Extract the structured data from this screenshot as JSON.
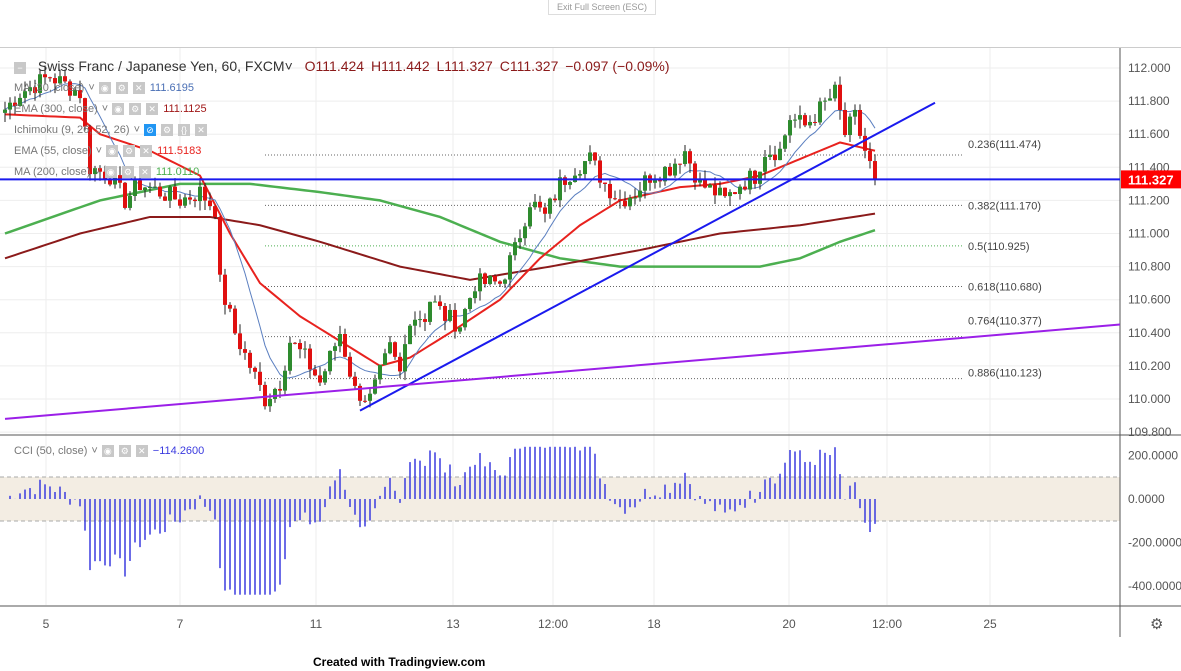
{
  "header": {
    "exit_fullscreen": "Exit Full Screen (ESC)"
  },
  "symbol": {
    "name": "Swiss Franc / Japanese Yen, 60, FXCM",
    "open": "O111.424",
    "high": "H111.442",
    "low": "L111.327",
    "close": "C111.327",
    "change": "−0.097 (−0.09%)"
  },
  "indicators": [
    {
      "label": "MA (20, close)",
      "value": "111.6195",
      "color": "#4a6fb5"
    },
    {
      "label": "EMA (300, close)",
      "value": "111.1125",
      "color": "#a01818"
    },
    {
      "label": "Ichimoku (9, 26, 52, 26)",
      "value": "",
      "color": "#999"
    },
    {
      "label": "EMA (55, close)",
      "value": "111.5183",
      "color": "#e8221e"
    },
    {
      "label": "MA (200, close)",
      "value": "111.0110",
      "color": "#4caf50"
    }
  ],
  "cci": {
    "label": "CCI (50, close)",
    "value": "−114.2600"
  },
  "last_price": "111.327",
  "credit": "Created with Tradingview.com",
  "chart_data": {
    "type": "candlestick",
    "title": "Swiss Franc / Japanese Yen, 60, FXCM",
    "ylim": [
      109.75,
      112.1
    ],
    "y_ticks": [
      "112.000",
      "111.800",
      "111.600",
      "111.400",
      "111.200",
      "111.000",
      "110.800",
      "110.600",
      "110.400",
      "110.200",
      "110.000",
      "109.800"
    ],
    "x_ticks": [
      "5",
      "7",
      "11",
      "13",
      "12:00",
      "18",
      "20",
      "12:00",
      "25"
    ],
    "cci_ticks": [
      "200.0000",
      "0.0000",
      "-200.0000",
      "-400.0000"
    ],
    "close_path": [
      [
        0,
        111.75
      ],
      [
        3,
        111.85
      ],
      [
        9,
        111.95
      ],
      [
        15,
        111.85
      ],
      [
        17,
        111.4
      ],
      [
        21,
        111.35
      ],
      [
        24,
        111.2
      ],
      [
        27,
        111.3
      ],
      [
        31,
        111.25
      ],
      [
        35,
        111.2
      ],
      [
        39,
        111.25
      ],
      [
        42,
        111.15
      ],
      [
        43,
        110.7
      ],
      [
        46,
        110.4
      ],
      [
        49,
        110.2
      ],
      [
        52,
        110.0
      ],
      [
        55,
        110.1
      ],
      [
        57,
        110.35
      ],
      [
        60,
        110.25
      ],
      [
        63,
        110.1
      ],
      [
        67,
        110.4
      ],
      [
        70,
        110.05
      ],
      [
        73,
        110.0
      ],
      [
        77,
        110.3
      ],
      [
        79,
        110.15
      ],
      [
        81,
        110.5
      ],
      [
        84,
        110.5
      ],
      [
        85,
        110.6
      ],
      [
        88,
        110.5
      ],
      [
        91,
        110.45
      ],
      [
        94,
        110.7
      ],
      [
        99,
        110.7
      ],
      [
        102,
        110.9
      ],
      [
        105,
        111.2
      ],
      [
        108,
        111.1
      ],
      [
        111,
        111.3
      ],
      [
        114,
        111.4
      ],
      [
        117,
        111.45
      ],
      [
        120,
        111.3
      ],
      [
        123,
        111.2
      ],
      [
        126,
        111.25
      ],
      [
        129,
        111.35
      ],
      [
        133,
        111.4
      ],
      [
        136,
        111.5
      ],
      [
        139,
        111.3
      ],
      [
        142,
        111.25
      ],
      [
        144,
        111.2
      ],
      [
        147,
        111.3
      ],
      [
        150,
        111.35
      ],
      [
        152,
        111.5
      ],
      [
        155,
        111.5
      ],
      [
        157,
        111.7
      ],
      [
        160,
        111.65
      ],
      [
        163,
        111.75
      ],
      [
        166,
        111.85
      ],
      [
        168,
        111.6
      ],
      [
        170,
        111.7
      ],
      [
        172,
        111.5
      ],
      [
        174,
        111.327
      ]
    ],
    "ema55": [
      [
        0,
        111.72
      ],
      [
        15,
        111.7
      ],
      [
        19,
        111.6
      ],
      [
        29,
        111.5
      ],
      [
        39,
        111.35
      ],
      [
        45,
        111.0
      ],
      [
        51,
        110.7
      ],
      [
        59,
        110.5
      ],
      [
        67,
        110.35
      ],
      [
        75,
        110.2
      ],
      [
        81,
        110.25
      ],
      [
        89,
        110.4
      ],
      [
        99,
        110.6
      ],
      [
        107,
        110.85
      ],
      [
        115,
        111.05
      ],
      [
        123,
        111.2
      ],
      [
        135,
        111.28
      ],
      [
        143,
        111.3
      ],
      [
        151,
        111.35
      ],
      [
        159,
        111.45
      ],
      [
        167,
        111.55
      ],
      [
        174,
        111.5
      ]
    ],
    "ma200": [
      [
        0,
        111.0
      ],
      [
        19,
        111.2
      ],
      [
        35,
        111.3
      ],
      [
        49,
        111.3
      ],
      [
        63,
        111.25
      ],
      [
        75,
        111.2
      ],
      [
        87,
        111.1
      ],
      [
        99,
        110.95
      ],
      [
        111,
        110.85
      ],
      [
        123,
        110.8
      ],
      [
        135,
        110.8
      ],
      [
        151,
        110.8
      ],
      [
        159,
        110.85
      ],
      [
        167,
        110.95
      ],
      [
        174,
        111.02
      ]
    ],
    "ema300": [
      [
        0,
        110.85
      ],
      [
        15,
        111.0
      ],
      [
        29,
        111.1
      ],
      [
        41,
        111.1
      ],
      [
        51,
        111.05
      ],
      [
        63,
        110.95
      ],
      [
        79,
        110.8
      ],
      [
        93,
        110.72
      ],
      [
        109,
        110.8
      ],
      [
        127,
        110.9
      ],
      [
        143,
        111.0
      ],
      [
        159,
        111.05
      ],
      [
        174,
        111.12
      ]
    ],
    "horizontal_line": 111.327,
    "fib_levels": [
      {
        "label": "0.236(111.474)",
        "price": 111.474
      },
      {
        "label": "0.382(111.170)",
        "price": 111.17
      },
      {
        "label": "0.5(110.925)",
        "price": 110.925
      },
      {
        "label": "0.618(110.680)",
        "price": 110.68
      },
      {
        "label": "0.764(110.377)",
        "price": 110.377
      },
      {
        "label": "0.886(110.123)",
        "price": 110.123
      }
    ],
    "trendline_up": [
      [
        71,
        109.93
      ],
      [
        186,
        111.79
      ]
    ],
    "trendline_support": [
      [
        0,
        109.88
      ],
      [
        223,
        110.45
      ]
    ]
  }
}
